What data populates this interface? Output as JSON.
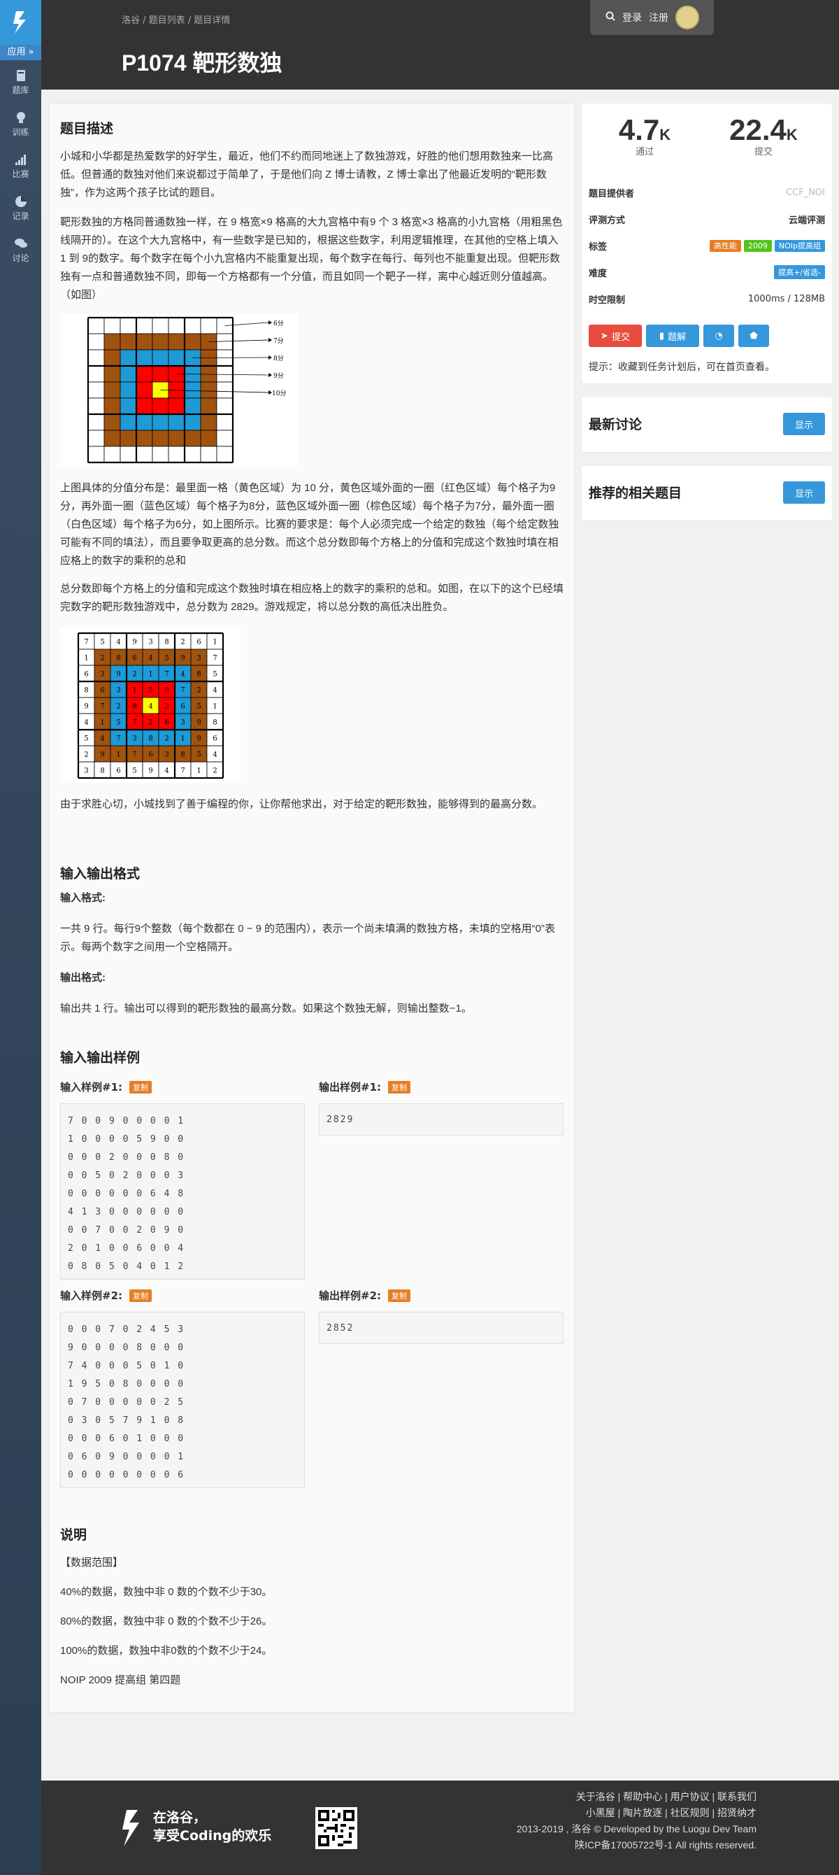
{
  "sidebar": {
    "app_label": "应用 »",
    "items": [
      {
        "label": "题库",
        "icon": "book-icon"
      },
      {
        "label": "训练",
        "icon": "lightbulb-icon"
      },
      {
        "label": "比赛",
        "icon": "bar-chart-icon"
      },
      {
        "label": "记录",
        "icon": "pie-chart-icon"
      },
      {
        "label": "讨论",
        "icon": "chat-icon"
      }
    ]
  },
  "header": {
    "breadcrumb": "洛谷 / 题目列表 / 题目详情",
    "title": "P1074 靶形数独",
    "login": "登录",
    "register": "注册"
  },
  "problem": {
    "desc_heading": "题目描述",
    "para1": "小城和小华都是热爱数学的好学生，最近，他们不约而同地迷上了数独游戏，好胜的他们想用数独来一比高低。但普通的数独对他们来说都过于简单了，于是他们向 Z 博士请教，Z 博士拿出了他最近发明的“靶形数独”，作为这两个孩子比试的题目。",
    "para2": "靶形数独的方格同普通数独一样，在 9 格宽×9 格高的大九宫格中有9 个 3 格宽×3 格高的小九宫格（用粗黑色线隔开的）。在这个大九宫格中，有一些数字是已知的，根据这些数字，利用逻辑推理，在其他的空格上填入 1 到 9的数字。每个数字在每个小九宫格内不能重复出现，每个数字在每行、每列也不能重复出现。但靶形数独有一点和普通数独不同，即每一个方格都有一个分值，而且如同一个靶子一样，离中心越近则分值越高。（如图）",
    "score_labels": [
      "6分",
      "7分",
      "8分",
      "9分",
      "10分"
    ],
    "para3": "上图具体的分值分布是：最里面一格（黄色区域）为 10 分，黄色区域外面的一圈（红色区域）每个格子为9分，再外面一圈（蓝色区域）每个格子为8分，蓝色区域外面一圈（棕色区域）每个格子为7分，最外面一圈（白色区域）每个格子为6分，如上图所示。比赛的要求是：每个人必须完成一个给定的数独（每个给定数独可能有不同的填法），而且要争取更高的总分数。而这个总分数即每个方格上的分值和完成这个数独时填在相应格上的数字的乘积的总和",
    "para4": "总分数即每个方格上的分值和完成这个数独时填在相应格上的数字的乘积的总和。如图，在以下的这个已经填完数字的靶形数独游戏中，总分数为 2829。游戏规定，将以总分数的高低决出胜负。",
    "grid": [
      [
        7,
        5,
        4,
        9,
        3,
        8,
        2,
        6,
        1
      ],
      [
        1,
        2,
        8,
        6,
        4,
        5,
        9,
        3,
        7
      ],
      [
        6,
        3,
        9,
        2,
        1,
        7,
        4,
        8,
        5
      ],
      [
        8,
        6,
        3,
        1,
        5,
        9,
        7,
        2,
        4
      ],
      [
        9,
        7,
        2,
        8,
        4,
        3,
        6,
        5,
        1
      ],
      [
        4,
        1,
        5,
        7,
        2,
        6,
        3,
        9,
        8
      ],
      [
        5,
        4,
        7,
        3,
        8,
        2,
        1,
        9,
        6
      ],
      [
        2,
        9,
        1,
        7,
        6,
        3,
        8,
        5,
        4
      ],
      [
        3,
        8,
        6,
        5,
        9,
        4,
        7,
        1,
        2
      ]
    ],
    "para5": "由于求胜心切，小城找到了善于编程的你，让你帮他求出，对于给定的靶形数独，能够得到的最高分数。",
    "io_heading": "输入输出格式",
    "input_label": "输入格式:",
    "input_text": "一共 9 行。每行9个整数（每个数都在 0 − 9 的范围内），表示一个尚未填满的数独方格，未填的空格用“0”表示。每两个数字之间用一个空格隔开。",
    "output_label": "输出格式:",
    "output_text": "输出共 1 行。输出可以得到的靶形数独的最高分数。如果这个数独无解，则输出整数−1。",
    "samples_heading": "输入输出样例",
    "samples": [
      {
        "in_label": "输入样例#1:",
        "out_label": "输出样例#1:",
        "input": "7 0 0 9 0 0 0 0 1\n1 0 0 0 0 5 9 0 0\n0 0 0 2 0 0 0 8 0\n0 0 5 0 2 0 0 0 3\n0 0 0 0 0 0 6 4 8\n4 1 3 0 0 0 0 0 0\n0 0 7 0 0 2 0 9 0\n2 0 1 0 0 6 0 0 4\n0 8 0 5 0 4 0 1 2",
        "output": "2829"
      },
      {
        "in_label": "输入样例#2:",
        "out_label": "输出样例#2:",
        "input": "0 0 0 7 0 2 4 5 3\n9 0 0 0 0 8 0 0 0\n7 4 0 0 0 5 0 1 0\n1 9 5 0 8 0 0 0 0\n0 7 0 0 0 0 0 2 5\n0 3 0 5 7 9 1 0 8\n0 0 0 6 0 1 0 0 0\n0 6 0 9 0 0 0 0 1\n0 0 0 0 0 0 0 0 6",
        "output": "2852"
      }
    ],
    "copy_label": "复制",
    "notes_heading": "说明",
    "notes": [
      "【数据范围】",
      "40%的数据，数独中非 0 数的个数不少于30。",
      "80%的数据，数独中非 0 数的个数不少于26。",
      "100%的数据，数独中非0数的个数不少于24。",
      "NOIP 2009 提高组 第四题"
    ]
  },
  "info": {
    "accepted": "4.7",
    "accepted_unit": "K",
    "accepted_label": "通过",
    "submitted": "22.4",
    "submitted_unit": "K",
    "submitted_label": "提交",
    "provider_label": "题目提供者",
    "provider": "CCF_NOI",
    "judge_label": "评测方式",
    "judge": "云端评测",
    "tags_label": "标签",
    "tags": [
      {
        "text": "高性能",
        "color": "#e67e22"
      },
      {
        "text": "2009",
        "color": "#52c41a"
      },
      {
        "text": "NOIp提高组",
        "color": "#3498db"
      }
    ],
    "difficulty_label": "难度",
    "difficulty": "提高+/省选-",
    "difficulty_color": "#3498db",
    "limit_label": "时空限制",
    "limit": "1000ms / 128MB",
    "submit_btn": "提交",
    "solution_btn": "题解",
    "hint": "提示：收藏到任务计划后，可在首页查看。"
  },
  "discussion": {
    "title": "最新讨论",
    "show": "显示"
  },
  "related": {
    "title": "推荐的相关题目",
    "show": "显示"
  },
  "footer": {
    "slogan1": "在洛谷，",
    "slogan2": "享受Coding的欢乐",
    "links1": "关于洛谷 | 帮助中心 | 用户协议 | 联系我们",
    "links2": "小黑屋 | 陶片放逐 | 社区规则 | 招贤纳才",
    "copyright": "2013-2019 , 洛谷 © Developed by the Luogu Dev Team",
    "icp": "陕ICP备17005722号-1 All rights reserved."
  }
}
